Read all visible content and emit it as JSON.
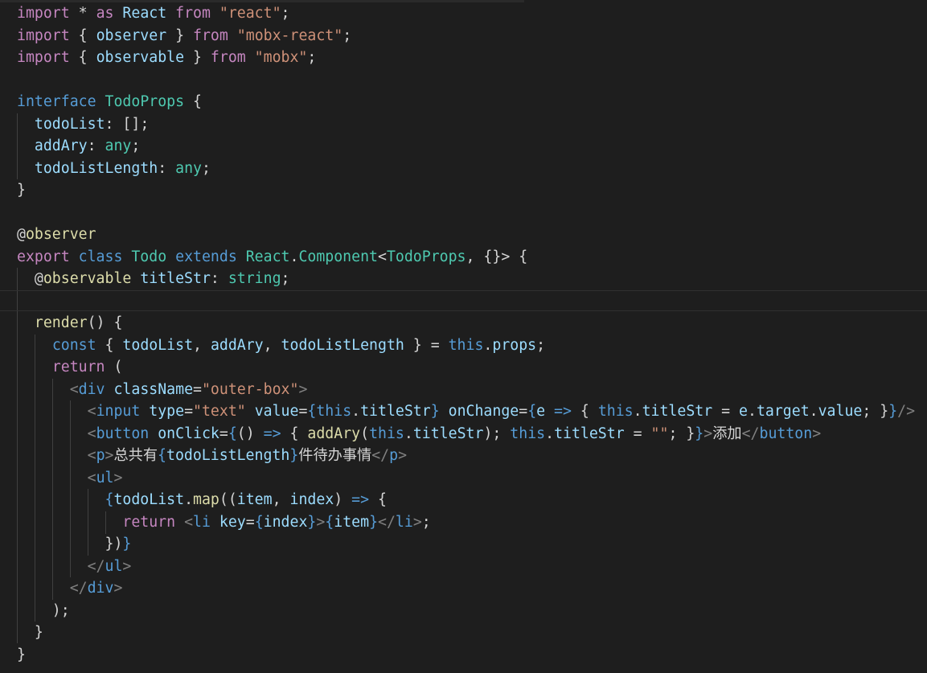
{
  "colors": {
    "background": "#1e1e1e",
    "keyword_control": "#c586c0",
    "keyword_storage": "#569cd6",
    "string": "#ce9178",
    "variable": "#9cdcfe",
    "type": "#4ec9b0",
    "function": "#dcdcaa",
    "tag_bracket": "#808080",
    "text": "#d4d4d4"
  },
  "editor": {
    "highlighted_line": 13,
    "lines": [
      [
        [
          "k",
          "import"
        ],
        [
          "p",
          " * "
        ],
        [
          "k",
          "as"
        ],
        [
          "v",
          " React "
        ],
        [
          "k",
          "from"
        ],
        [
          "s",
          " \"react\""
        ],
        [
          "p",
          ";"
        ]
      ],
      [
        [
          "k",
          "import"
        ],
        [
          "p",
          " { "
        ],
        [
          "v",
          "observer"
        ],
        [
          "p",
          " } "
        ],
        [
          "k",
          "from"
        ],
        [
          "s",
          " \"mobx-react\""
        ],
        [
          "p",
          ";"
        ]
      ],
      [
        [
          "k",
          "import"
        ],
        [
          "p",
          " { "
        ],
        [
          "v",
          "observable"
        ],
        [
          "p",
          " } "
        ],
        [
          "k",
          "from"
        ],
        [
          "s",
          " \"mobx\""
        ],
        [
          "p",
          ";"
        ]
      ],
      [],
      [
        [
          "b",
          "interface"
        ],
        [
          "p",
          " "
        ],
        [
          "t",
          "TodoProps"
        ],
        [
          "p",
          " {"
        ]
      ],
      [
        [
          "p",
          "  "
        ],
        [
          "v",
          "todoList"
        ],
        [
          "p",
          ": [];"
        ]
      ],
      [
        [
          "p",
          "  "
        ],
        [
          "v",
          "addAry"
        ],
        [
          "p",
          ": "
        ],
        [
          "t",
          "any"
        ],
        [
          "p",
          ";"
        ]
      ],
      [
        [
          "p",
          "  "
        ],
        [
          "v",
          "todoListLength"
        ],
        [
          "p",
          ": "
        ],
        [
          "t",
          "any"
        ],
        [
          "p",
          ";"
        ]
      ],
      [
        [
          "p",
          "}"
        ]
      ],
      [],
      [
        [
          "p",
          "@"
        ],
        [
          "f",
          "observer"
        ]
      ],
      [
        [
          "k",
          "export"
        ],
        [
          "p",
          " "
        ],
        [
          "b",
          "class"
        ],
        [
          "p",
          " "
        ],
        [
          "t",
          "Todo"
        ],
        [
          "p",
          " "
        ],
        [
          "b",
          "extends"
        ],
        [
          "p",
          " "
        ],
        [
          "t",
          "React"
        ],
        [
          "p",
          "."
        ],
        [
          "t",
          "Component"
        ],
        [
          "p",
          "<"
        ],
        [
          "t",
          "TodoProps"
        ],
        [
          "p",
          ", {}> {"
        ]
      ],
      [
        [
          "p",
          "  @"
        ],
        [
          "f",
          "observable"
        ],
        [
          "p",
          " "
        ],
        [
          "v",
          "titleStr"
        ],
        [
          "p",
          ": "
        ],
        [
          "t",
          "string"
        ],
        [
          "p",
          ";"
        ]
      ],
      [],
      [
        [
          "p",
          "  "
        ],
        [
          "f",
          "render"
        ],
        [
          "p",
          "() {"
        ]
      ],
      [
        [
          "p",
          "    "
        ],
        [
          "b",
          "const"
        ],
        [
          "p",
          " { "
        ],
        [
          "v",
          "todoList"
        ],
        [
          "p",
          ", "
        ],
        [
          "v",
          "addAry"
        ],
        [
          "p",
          ", "
        ],
        [
          "v",
          "todoListLength"
        ],
        [
          "p",
          " } = "
        ],
        [
          "b",
          "this"
        ],
        [
          "p",
          "."
        ],
        [
          "v",
          "props"
        ],
        [
          "p",
          ";"
        ]
      ],
      [
        [
          "p",
          "    "
        ],
        [
          "k",
          "return"
        ],
        [
          "p",
          " ("
        ]
      ],
      [
        [
          "p",
          "      "
        ],
        [
          "g",
          "<"
        ],
        [
          "b",
          "div"
        ],
        [
          "p",
          " "
        ],
        [
          "v",
          "className"
        ],
        [
          "p",
          "="
        ],
        [
          "s",
          "\"outer-box\""
        ],
        [
          "g",
          ">"
        ]
      ],
      [
        [
          "p",
          "        "
        ],
        [
          "g",
          "<"
        ],
        [
          "b",
          "input"
        ],
        [
          "p",
          " "
        ],
        [
          "v",
          "type"
        ],
        [
          "p",
          "="
        ],
        [
          "s",
          "\"text\""
        ],
        [
          "p",
          " "
        ],
        [
          "v",
          "value"
        ],
        [
          "p",
          "="
        ],
        [
          "b",
          "{"
        ],
        [
          "b",
          "this"
        ],
        [
          "p",
          "."
        ],
        [
          "v",
          "titleStr"
        ],
        [
          "b",
          "}"
        ],
        [
          "p",
          " "
        ],
        [
          "v",
          "onChange"
        ],
        [
          "p",
          "="
        ],
        [
          "b",
          "{"
        ],
        [
          "v",
          "e"
        ],
        [
          "p",
          " "
        ],
        [
          "b",
          "=>"
        ],
        [
          "p",
          " { "
        ],
        [
          "b",
          "this"
        ],
        [
          "p",
          "."
        ],
        [
          "v",
          "titleStr"
        ],
        [
          "p",
          " = "
        ],
        [
          "v",
          "e"
        ],
        [
          "p",
          "."
        ],
        [
          "v",
          "target"
        ],
        [
          "p",
          "."
        ],
        [
          "v",
          "value"
        ],
        [
          "p",
          "; }"
        ],
        [
          "b",
          "}"
        ],
        [
          "g",
          "/>"
        ]
      ],
      [
        [
          "p",
          "        "
        ],
        [
          "g",
          "<"
        ],
        [
          "b",
          "button"
        ],
        [
          "p",
          " "
        ],
        [
          "v",
          "onClick"
        ],
        [
          "p",
          "="
        ],
        [
          "b",
          "{"
        ],
        [
          "p",
          "() "
        ],
        [
          "b",
          "=>"
        ],
        [
          "p",
          " { "
        ],
        [
          "f",
          "addAry"
        ],
        [
          "p",
          "("
        ],
        [
          "b",
          "this"
        ],
        [
          "p",
          "."
        ],
        [
          "v",
          "titleStr"
        ],
        [
          "p",
          "); "
        ],
        [
          "b",
          "this"
        ],
        [
          "p",
          "."
        ],
        [
          "v",
          "titleStr"
        ],
        [
          "p",
          " = "
        ],
        [
          "s",
          "\"\""
        ],
        [
          "p",
          "; }"
        ],
        [
          "b",
          "}"
        ],
        [
          "g",
          ">"
        ],
        [
          "p",
          "添加"
        ],
        [
          "g",
          "</"
        ],
        [
          "b",
          "button"
        ],
        [
          "g",
          ">"
        ]
      ],
      [
        [
          "p",
          "        "
        ],
        [
          "g",
          "<"
        ],
        [
          "b",
          "p"
        ],
        [
          "g",
          ">"
        ],
        [
          "p",
          "总共有"
        ],
        [
          "b",
          "{"
        ],
        [
          "v",
          "todoListLength"
        ],
        [
          "b",
          "}"
        ],
        [
          "p",
          "件待办事情"
        ],
        [
          "g",
          "</"
        ],
        [
          "b",
          "p"
        ],
        [
          "g",
          ">"
        ]
      ],
      [
        [
          "p",
          "        "
        ],
        [
          "g",
          "<"
        ],
        [
          "b",
          "ul"
        ],
        [
          "g",
          ">"
        ]
      ],
      [
        [
          "p",
          "          "
        ],
        [
          "b",
          "{"
        ],
        [
          "v",
          "todoList"
        ],
        [
          "p",
          "."
        ],
        [
          "f",
          "map"
        ],
        [
          "p",
          "(("
        ],
        [
          "v",
          "item"
        ],
        [
          "p",
          ", "
        ],
        [
          "v",
          "index"
        ],
        [
          "p",
          ") "
        ],
        [
          "b",
          "=>"
        ],
        [
          "p",
          " {"
        ]
      ],
      [
        [
          "p",
          "            "
        ],
        [
          "k",
          "return"
        ],
        [
          "p",
          " "
        ],
        [
          "g",
          "<"
        ],
        [
          "b",
          "li"
        ],
        [
          "p",
          " "
        ],
        [
          "v",
          "key"
        ],
        [
          "p",
          "="
        ],
        [
          "b",
          "{"
        ],
        [
          "v",
          "index"
        ],
        [
          "b",
          "}"
        ],
        [
          "g",
          ">"
        ],
        [
          "b",
          "{"
        ],
        [
          "v",
          "item"
        ],
        [
          "b",
          "}"
        ],
        [
          "g",
          "</"
        ],
        [
          "b",
          "li"
        ],
        [
          "g",
          ">"
        ],
        [
          "p",
          ";"
        ]
      ],
      [
        [
          "p",
          "          })"
        ],
        [
          "b",
          "}"
        ]
      ],
      [
        [
          "p",
          "        "
        ],
        [
          "g",
          "</"
        ],
        [
          "b",
          "ul"
        ],
        [
          "g",
          ">"
        ]
      ],
      [
        [
          "p",
          "      "
        ],
        [
          "g",
          "</"
        ],
        [
          "b",
          "div"
        ],
        [
          "g",
          ">"
        ]
      ],
      [
        [
          "p",
          "    );"
        ]
      ],
      [
        [
          "p",
          "  }"
        ]
      ],
      [
        [
          "p",
          "}"
        ]
      ]
    ]
  }
}
